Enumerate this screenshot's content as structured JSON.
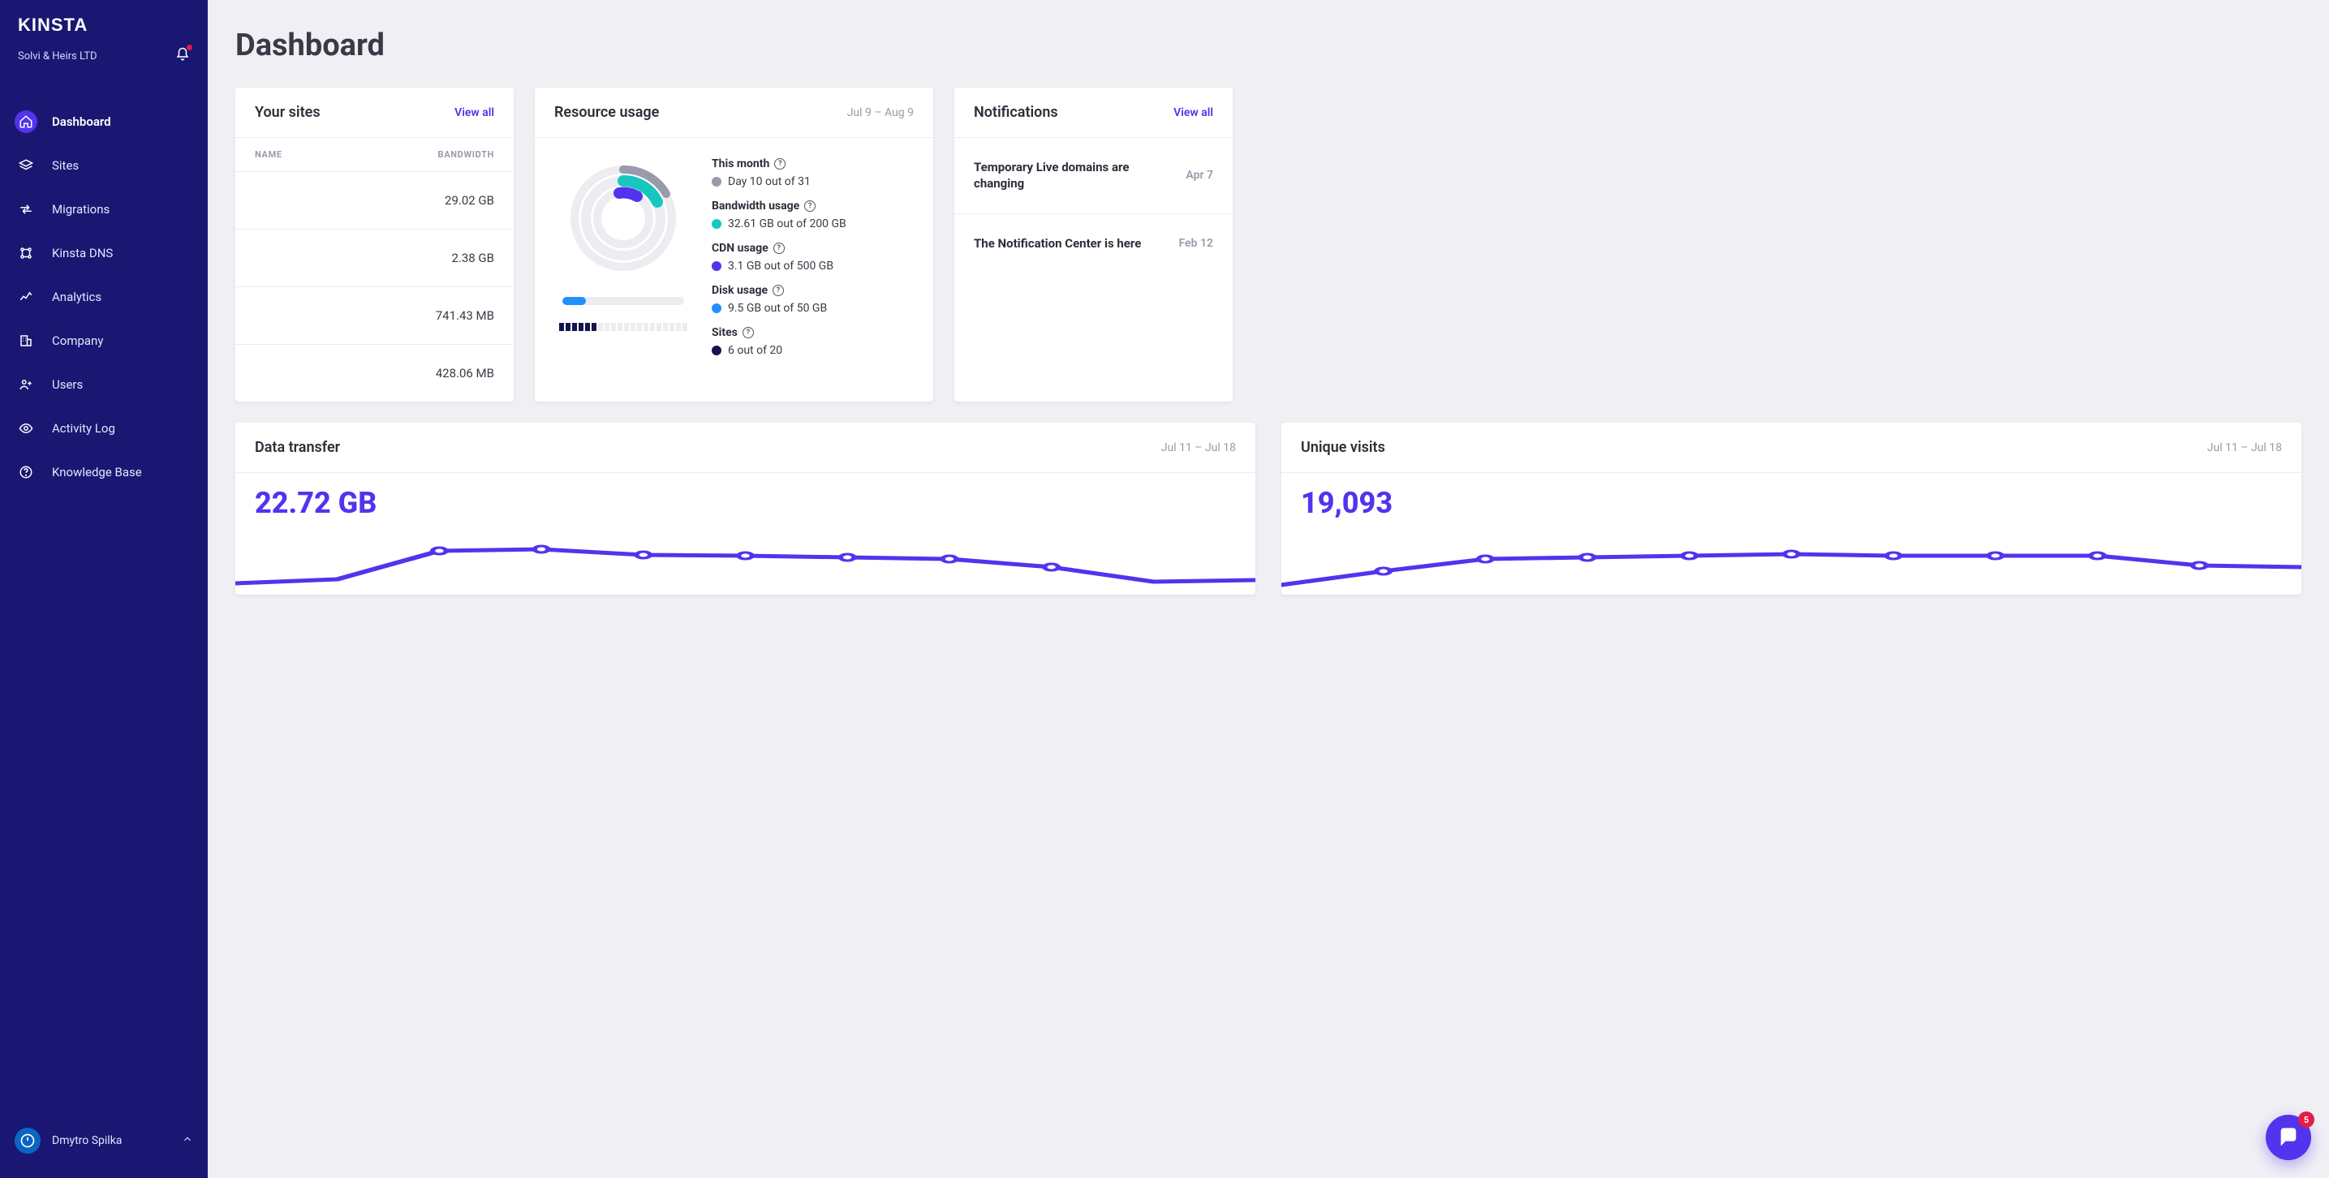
{
  "brand": "KINSTA",
  "company_name": "Solvi & Heirs LTD",
  "sidebar": {
    "items": [
      {
        "label": "Dashboard",
        "active": true
      },
      {
        "label": "Sites",
        "active": false
      },
      {
        "label": "Migrations",
        "active": false
      },
      {
        "label": "Kinsta DNS",
        "active": false
      },
      {
        "label": "Analytics",
        "active": false
      },
      {
        "label": "Company",
        "active": false
      },
      {
        "label": "Users",
        "active": false
      },
      {
        "label": "Activity Log",
        "active": false
      },
      {
        "label": "Knowledge Base",
        "active": false
      }
    ]
  },
  "user_name": "Dmytro Spilka",
  "page": {
    "title": "Dashboard"
  },
  "your_sites": {
    "title": "Your sites",
    "view_all": "View all",
    "columns": {
      "name": "NAME",
      "bandwidth": "BANDWIDTH"
    },
    "rows": [
      {
        "bandwidth": "29.02 GB"
      },
      {
        "bandwidth": "2.38 GB"
      },
      {
        "bandwidth": "741.43 MB"
      },
      {
        "bandwidth": "428.06 MB"
      }
    ]
  },
  "resource": {
    "title": "Resource usage",
    "date_range": "Jul 9 – Aug 9",
    "this_month": {
      "label": "This month",
      "value": "Day 10 out of 31",
      "dot": "#9a9aac",
      "day": 10,
      "total_days": 31
    },
    "bandwidth": {
      "label": "Bandwidth usage",
      "value": "32.61 GB out of 200 GB",
      "dot": "#17c7bd",
      "used": 32.61,
      "limit": 200,
      "unit": "GB"
    },
    "cdn": {
      "label": "CDN usage",
      "value": "3.1 GB out of 500 GB",
      "dot": "#5333ed",
      "used": 3.1,
      "limit": 500,
      "unit": "GB"
    },
    "disk": {
      "label": "Disk usage",
      "value": "9.5 GB out of 50 GB",
      "dot": "#2490ff",
      "used": 9.5,
      "limit": 50,
      "unit": "GB",
      "percent": 19
    },
    "sites": {
      "label": "Sites",
      "value": "6 out of 20",
      "dot": "#141452",
      "used": 6,
      "limit": 20
    }
  },
  "notifications": {
    "title": "Notifications",
    "view_all": "View all",
    "items": [
      {
        "title": "Temporary Live domains are changing",
        "date": "Apr 7"
      },
      {
        "title": "The Notification Center is here",
        "date": "Feb 12"
      }
    ]
  },
  "data_transfer": {
    "title": "Data transfer",
    "date_range": "Jul 11 – Jul 18",
    "value": "22.72 GB"
  },
  "unique_visits": {
    "title": "Unique visits",
    "date_range": "Jul 11 – Jul 18",
    "value": "19,093"
  },
  "chat_badge": "5",
  "colors": {
    "sidebar_bg": "#1a1772",
    "accent": "#5333ed",
    "teal": "#17c7bd",
    "blue": "#2490ff",
    "navy": "#141452",
    "grey": "#9a9aac"
  },
  "chart_data": [
    {
      "type": "bar",
      "title": "Disk usage",
      "categories": [
        "used"
      ],
      "values": [
        19
      ],
      "ylim": [
        0,
        100
      ],
      "ylabel": "percent"
    },
    {
      "type": "bar",
      "title": "Sites used",
      "categories": [
        "used",
        "limit"
      ],
      "values": [
        6,
        20
      ]
    },
    {
      "type": "pie",
      "title": "Resource usage rings",
      "series": [
        {
          "name": "This month",
          "values": [
            32,
            100
          ]
        },
        {
          "name": "Bandwidth usage",
          "values": [
            16,
            100
          ]
        },
        {
          "name": "CDN usage",
          "values": [
            1,
            100
          ]
        }
      ]
    },
    {
      "type": "line",
      "title": "Data transfer",
      "x": [
        1,
        2,
        3,
        4,
        5,
        6,
        7,
        8
      ],
      "series": [
        {
          "name": "GB",
          "values": [
            2.2,
            3.4,
            3.5,
            3.3,
            3.2,
            3.1,
            2.6,
            1.4
          ]
        }
      ],
      "xlabel": "Jul 11 – Jul 18",
      "ylabel": "GB"
    },
    {
      "type": "line",
      "title": "Unique visits",
      "x": [
        1,
        2,
        3,
        4,
        5,
        6,
        7,
        8
      ],
      "series": [
        {
          "name": "visits",
          "values": [
            1900,
            2700,
            2800,
            2800,
            2900,
            2800,
            2800,
            2300
          ]
        }
      ],
      "xlabel": "Jul 11 – Jul 18",
      "ylabel": "visits"
    }
  ]
}
